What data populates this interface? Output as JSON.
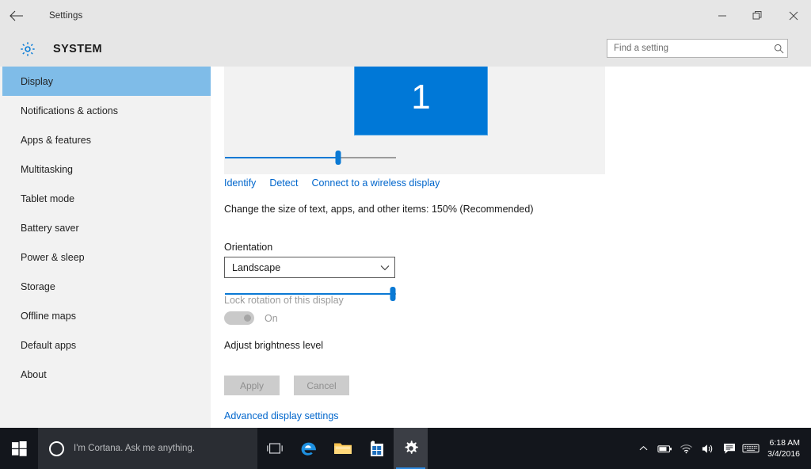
{
  "window": {
    "back_icon": "back-arrow-icon",
    "title": "Settings",
    "minimize_label": "minimize-icon",
    "restore_label": "restore-icon",
    "close_label": "close-icon"
  },
  "header": {
    "gear_icon": "gear-icon",
    "title": "SYSTEM",
    "search": {
      "placeholder": "Find a setting",
      "value": "",
      "icon": "search-icon"
    }
  },
  "sidebar": {
    "items": [
      {
        "label": "Display",
        "selected": true
      },
      {
        "label": "Notifications & actions",
        "selected": false
      },
      {
        "label": "Apps & features",
        "selected": false
      },
      {
        "label": "Multitasking",
        "selected": false
      },
      {
        "label": "Tablet mode",
        "selected": false
      },
      {
        "label": "Battery saver",
        "selected": false
      },
      {
        "label": "Power & sleep",
        "selected": false
      },
      {
        "label": "Storage",
        "selected": false
      },
      {
        "label": "Offline maps",
        "selected": false
      },
      {
        "label": "Default apps",
        "selected": false
      },
      {
        "label": "About",
        "selected": false
      }
    ]
  },
  "main": {
    "monitor": {
      "number": "1",
      "color": "#0078d7"
    },
    "links": [
      {
        "label": "Identify"
      },
      {
        "label": "Detect"
      },
      {
        "label": "Connect to a wireless display"
      }
    ],
    "scale": {
      "label": "Change the size of text, apps, and other items: 150% (Recommended)",
      "value": 66,
      "percent_text": "150%"
    },
    "orientation": {
      "label": "Orientation",
      "value": "Landscape",
      "chevron_icon": "chevron-down-icon"
    },
    "lock_rotation": {
      "label": "Lock rotation of this display",
      "state_label": "On",
      "enabled": false,
      "checked": true
    },
    "brightness": {
      "label": "Adjust brightness level",
      "value": 98
    },
    "buttons": {
      "apply": "Apply",
      "cancel": "Cancel"
    },
    "advanced_link": "Advanced display settings"
  },
  "taskbar": {
    "start_icon": "windows-start-icon",
    "cortana": {
      "icon": "cortana-circle-icon",
      "placeholder": "I'm Cortana. Ask me anything."
    },
    "apps": [
      {
        "name": "task-view-icon"
      },
      {
        "name": "edge-browser-icon"
      },
      {
        "name": "file-explorer-icon"
      },
      {
        "name": "store-icon"
      },
      {
        "name": "settings-gear-icon",
        "active": true
      }
    ],
    "tray": [
      {
        "name": "chevron-up-icon"
      },
      {
        "name": "battery-icon"
      },
      {
        "name": "wifi-icon"
      },
      {
        "name": "volume-icon"
      },
      {
        "name": "action-center-icon"
      },
      {
        "name": "keyboard-icon"
      }
    ],
    "clock": {
      "time": "6:18 AM",
      "date": "3/4/2016"
    }
  },
  "colors": {
    "accent": "#0078d7",
    "link": "#0066cc",
    "selection": "#7fbce8",
    "chrome": "#e6e6e6",
    "sidebar_bg": "#f2f2f2",
    "taskbar_bg": "#13161c"
  }
}
